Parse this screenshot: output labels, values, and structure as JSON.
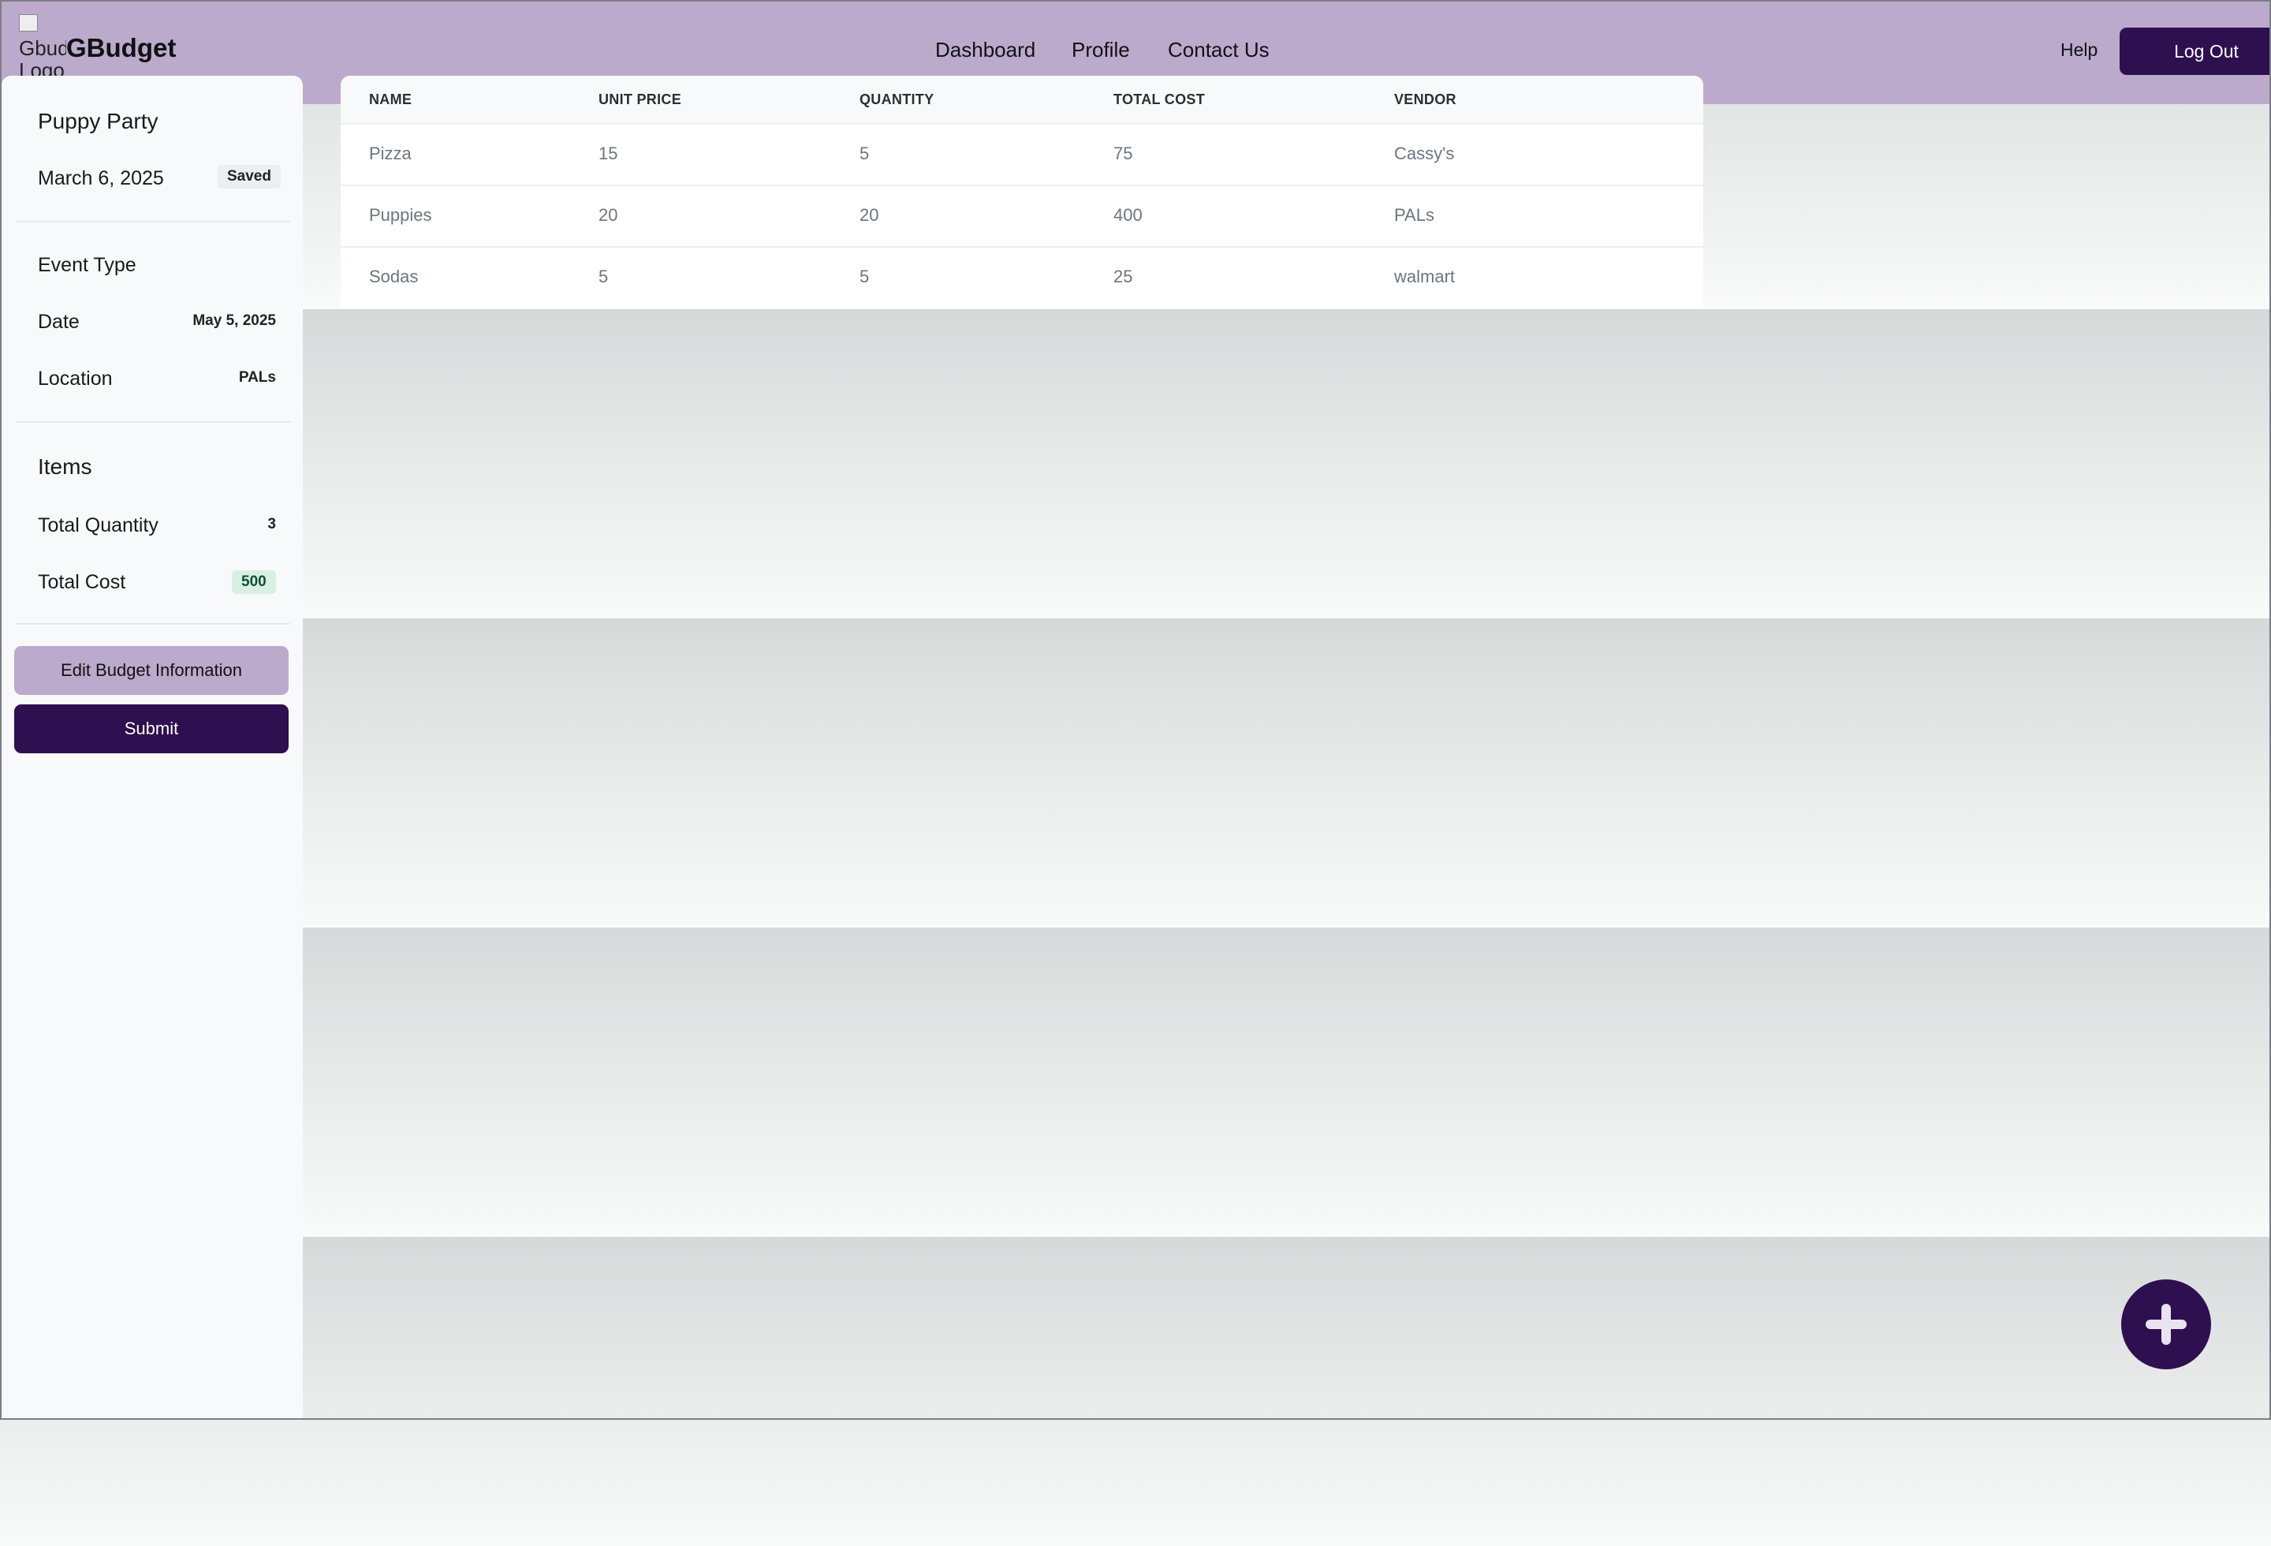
{
  "header": {
    "logo_alt": "Gbudget Logo",
    "brand": "GBudget",
    "nav": [
      {
        "label": "Dashboard"
      },
      {
        "label": "Profile"
      },
      {
        "label": "Contact Us"
      }
    ],
    "help_label": "Help",
    "logout_label": "Log Out"
  },
  "sidebar": {
    "title": "Puppy Party",
    "created_date": "March 6, 2025",
    "status_badge": "Saved",
    "event_type_label": "Event Type",
    "date_label": "Date",
    "date_value": "May 5, 2025",
    "location_label": "Location",
    "location_value": "PALs",
    "items_label": "Items",
    "total_quantity_label": "Total Quantity",
    "total_quantity_value": "3",
    "total_cost_label": "Total Cost",
    "total_cost_value": "500",
    "edit_button": "Edit Budget Information",
    "submit_button": "Submit"
  },
  "table": {
    "columns": [
      "NAME",
      "UNIT PRICE",
      "QUANTITY",
      "TOTAL COST",
      "VENDOR"
    ],
    "rows": [
      [
        "Pizza",
        "15",
        "5",
        "75",
        "Cassy's"
      ],
      [
        "Puppies",
        "20",
        "20",
        "400",
        "PALs"
      ],
      [
        "Sodas",
        "5",
        "5",
        "25",
        "walmart"
      ]
    ]
  },
  "fab": {
    "icon": "plus-icon"
  },
  "colors": {
    "header_bg": "#bcaacd",
    "primary_dark": "#2e0f4f",
    "sidebar_bg": "#f8f9fa",
    "success_badge_bg": "#d8f0e3"
  }
}
